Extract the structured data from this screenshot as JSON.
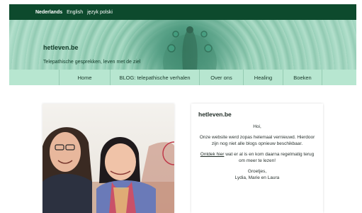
{
  "languages": [
    {
      "label": "Nederlands",
      "active": true
    },
    {
      "label": "English",
      "active": false
    },
    {
      "label": "język polski",
      "active": false
    }
  ],
  "header": {
    "site_title": "hetleven.be",
    "tagline": "Telepathische gesprekken, leven met de ziel"
  },
  "nav": {
    "items": [
      "Home",
      "BLOG: telepathische verhalen",
      "Over ons",
      "Healing",
      "Boeken"
    ]
  },
  "info": {
    "title": "hetleven.be",
    "greeting": "Hoi,",
    "message": "Onze website werd zopas helemaal vernieuwd. Hierdoor zijn nog niet alle blogs opnieuw beschikbaar.",
    "link_text": "Ontdek hier",
    "message2": "wat er al is en kom daarna regelmatig terug om meer te lezen!",
    "closing": "Groetjes,",
    "signature": "Lydia, Marie en Laura"
  },
  "colors": {
    "topbar": "#0d4a2d",
    "nav": "#b7e6d0"
  },
  "icons": {
    "banner": "peacock-illustration",
    "photo": "two-women-selfie"
  }
}
